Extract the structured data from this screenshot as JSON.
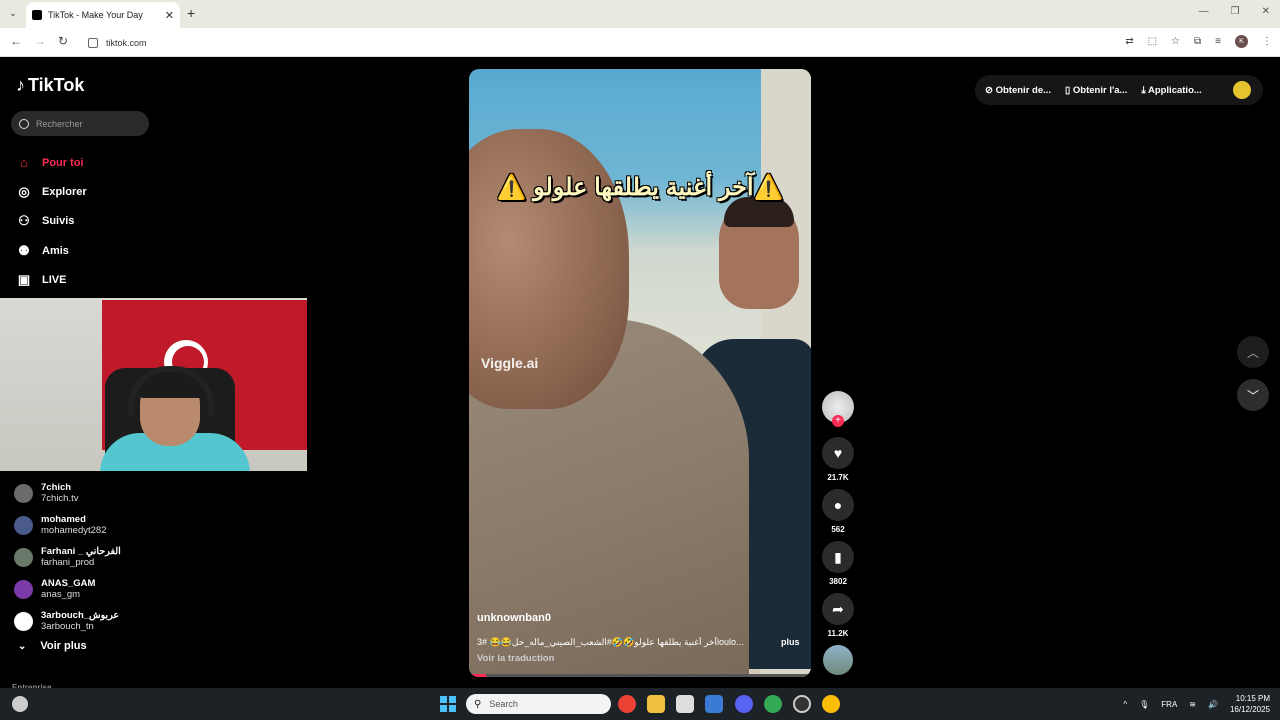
{
  "browser": {
    "tab_title": "TikTok - Make Your Day",
    "url": "tiktok.com"
  },
  "sidebar": {
    "logo_text": "TikTok",
    "search_placeholder": "Rechercher",
    "nav": [
      {
        "label": "Pour toi",
        "icon": "home-icon"
      },
      {
        "label": "Explorer",
        "icon": "compass-icon"
      },
      {
        "label": "Suivis",
        "icon": "following-icon"
      },
      {
        "label": "Amis",
        "icon": "friends-icon"
      },
      {
        "label": "LIVE",
        "icon": "live-icon"
      }
    ],
    "following": [
      {
        "name": "7chich",
        "handle": "7chich.tv",
        "color": "#6b6b6b"
      },
      {
        "name": "mohamed",
        "handle": "mohamedyt282",
        "color": "#4a5a8a"
      },
      {
        "name": "Farhani _ الفرحاني",
        "handle": "farhani_prod",
        "color": "#6a7a6a"
      },
      {
        "name": "ANAS_GAM",
        "handle": "anas_gm",
        "color": "#7a3aa8"
      },
      {
        "name": "3arbouch_عربوش",
        "handle": "3arbouch_tn",
        "color": "#ffffff"
      }
    ],
    "see_more": "Voir plus",
    "section_label": "Entreprise"
  },
  "video": {
    "overlay_title": "⚠️آخر أغنية يطلقها علولو ⚠️",
    "watermark": "Viggle.ai",
    "username": "unknownban0",
    "caption": "آخر أغنية يطلقها علولو🤣🤣#الشعب_الصيني_ماله_حل😂😂 #3loulo...",
    "more": "plus",
    "translate": "Voir la traduction",
    "progress_fraction": 0.05
  },
  "actions": {
    "likes": "21.7K",
    "comments": "562",
    "saves": "3802",
    "shares": "11.2K"
  },
  "top_right": {
    "item1": "Obtenir de...",
    "item2": "Obtenir l'a...",
    "item3": "Applicatio..."
  },
  "taskbar": {
    "search_placeholder": "Search",
    "lang": "FRA",
    "time": "10:15 PM",
    "date": "16/12/2025"
  },
  "colors": {
    "accent": "#fe2c55",
    "background": "#000000"
  }
}
